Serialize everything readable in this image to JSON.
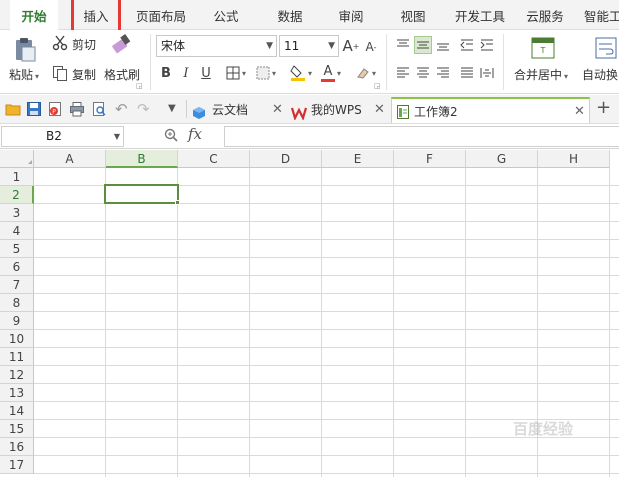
{
  "menu": {
    "tabs": [
      {
        "label": "开始",
        "active": true
      },
      {
        "label": "插入",
        "active": false
      },
      {
        "label": "页面布局",
        "active": false
      },
      {
        "label": "公式",
        "active": false
      },
      {
        "label": "数据",
        "active": false
      },
      {
        "label": "审阅",
        "active": false
      },
      {
        "label": "视图",
        "active": false
      },
      {
        "label": "开发工具",
        "active": false
      },
      {
        "label": "云服务",
        "active": false
      },
      {
        "label": "智能工",
        "active": false
      }
    ]
  },
  "ribbon": {
    "paste_label": "粘贴",
    "cut_label": "剪切",
    "copy_label": "复制",
    "format_painter_label": "格式刷",
    "font_name": "宋体",
    "font_size": "11",
    "merge_center_label": "合并居中",
    "wrap_label": "自动换",
    "bold": "B",
    "italic": "I",
    "underline": "U",
    "font_color_letter": "A",
    "grow_font": "A",
    "shrink_font": "A"
  },
  "doc_tabs": [
    {
      "label": "云文档",
      "active": false
    },
    {
      "label": "我的WPS",
      "active": false
    },
    {
      "label": "工作簿2",
      "active": true
    }
  ],
  "formula_bar": {
    "cell_ref": "B2",
    "fx_label": "fx",
    "value": ""
  },
  "sheet": {
    "columns": [
      "A",
      "B",
      "C",
      "D",
      "E",
      "F",
      "G",
      "H"
    ],
    "rows": [
      "1",
      "2",
      "3",
      "4",
      "5",
      "6",
      "7",
      "8",
      "9",
      "10",
      "11",
      "12",
      "13",
      "14",
      "15",
      "16",
      "17"
    ],
    "selected_column": "B",
    "selected_row": "2"
  },
  "colors": {
    "accent_green": "#2e7d32",
    "highlight_red": "#e53935",
    "selection_border": "#5b8f3c"
  },
  "watermark": "百度经验"
}
